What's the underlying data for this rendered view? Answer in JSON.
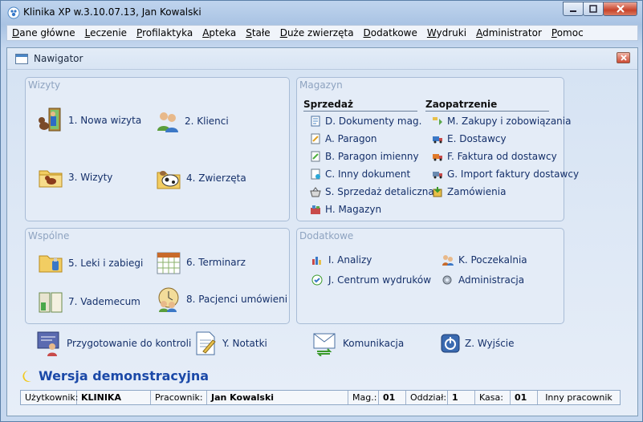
{
  "window": {
    "title": "Klinika XP w.3.10.07.13, Jan Kowalski",
    "min": "0",
    "max": "1",
    "close": "x"
  },
  "menu": [
    "Dane główne",
    "Leczenie",
    "Profilaktyka",
    "Apteka",
    "Stałe",
    "Duże zwierzęta",
    "Dodatkowe",
    "Wydruki",
    "Administrator",
    "Pomoc"
  ],
  "navigator": {
    "title": "Nawigator",
    "close": "x"
  },
  "wizyty": {
    "title": "Wizyty",
    "items": [
      "1. Nowa wizyta",
      "2. Klienci",
      "3. Wizyty",
      "4. Zwierzęta"
    ]
  },
  "wspolne": {
    "title": "Wspólne",
    "items": [
      "5. Leki i zabiegi",
      "6. Terminarz",
      "7. Vademecum",
      "8. Pacjenci umówieni"
    ]
  },
  "magazyn": {
    "title": "Magazyn",
    "sprzedaz": "Sprzedaż",
    "zaopatrzenie": "Zaopatrzenie",
    "sales": [
      "D. Dokumenty mag.",
      "A. Paragon",
      "B. Paragon imienny",
      "C. Inny dokument",
      "S. Sprzedaż detaliczna",
      "H. Magazyn"
    ],
    "supply": [
      "M. Zakupy i zobowiązania",
      "E. Dostawcy",
      "F. Faktura od dostawcy",
      "G. Import faktury dostawcy",
      "Zamówienia"
    ]
  },
  "dodatkowe": {
    "title": "Dodatkowe",
    "items": [
      "I. Analizy",
      "K. Poczekalnia",
      "J. Centrum wydruków",
      "Administracja"
    ]
  },
  "bottom": [
    "Przygotowanie do kontroli",
    "Y. Notatki",
    "Komunikacja",
    "Z. Wyjście"
  ],
  "demo": "Wersja demonstracyjna",
  "status": {
    "user_label": "Użytkownik:",
    "user": "KLINIKA",
    "worker_label": "Pracownik:",
    "worker": "Jan Kowalski",
    "mag_label": "Mag.:",
    "mag": "01",
    "dept_label": "Oddział:",
    "dept": "1",
    "cash_label": "Kasa:",
    "cash": "01",
    "other": "Inny pracownik"
  },
  "colors": {
    "accent": "#1b49a8",
    "link": "#15306a",
    "group_title": "#8ea3c0"
  }
}
